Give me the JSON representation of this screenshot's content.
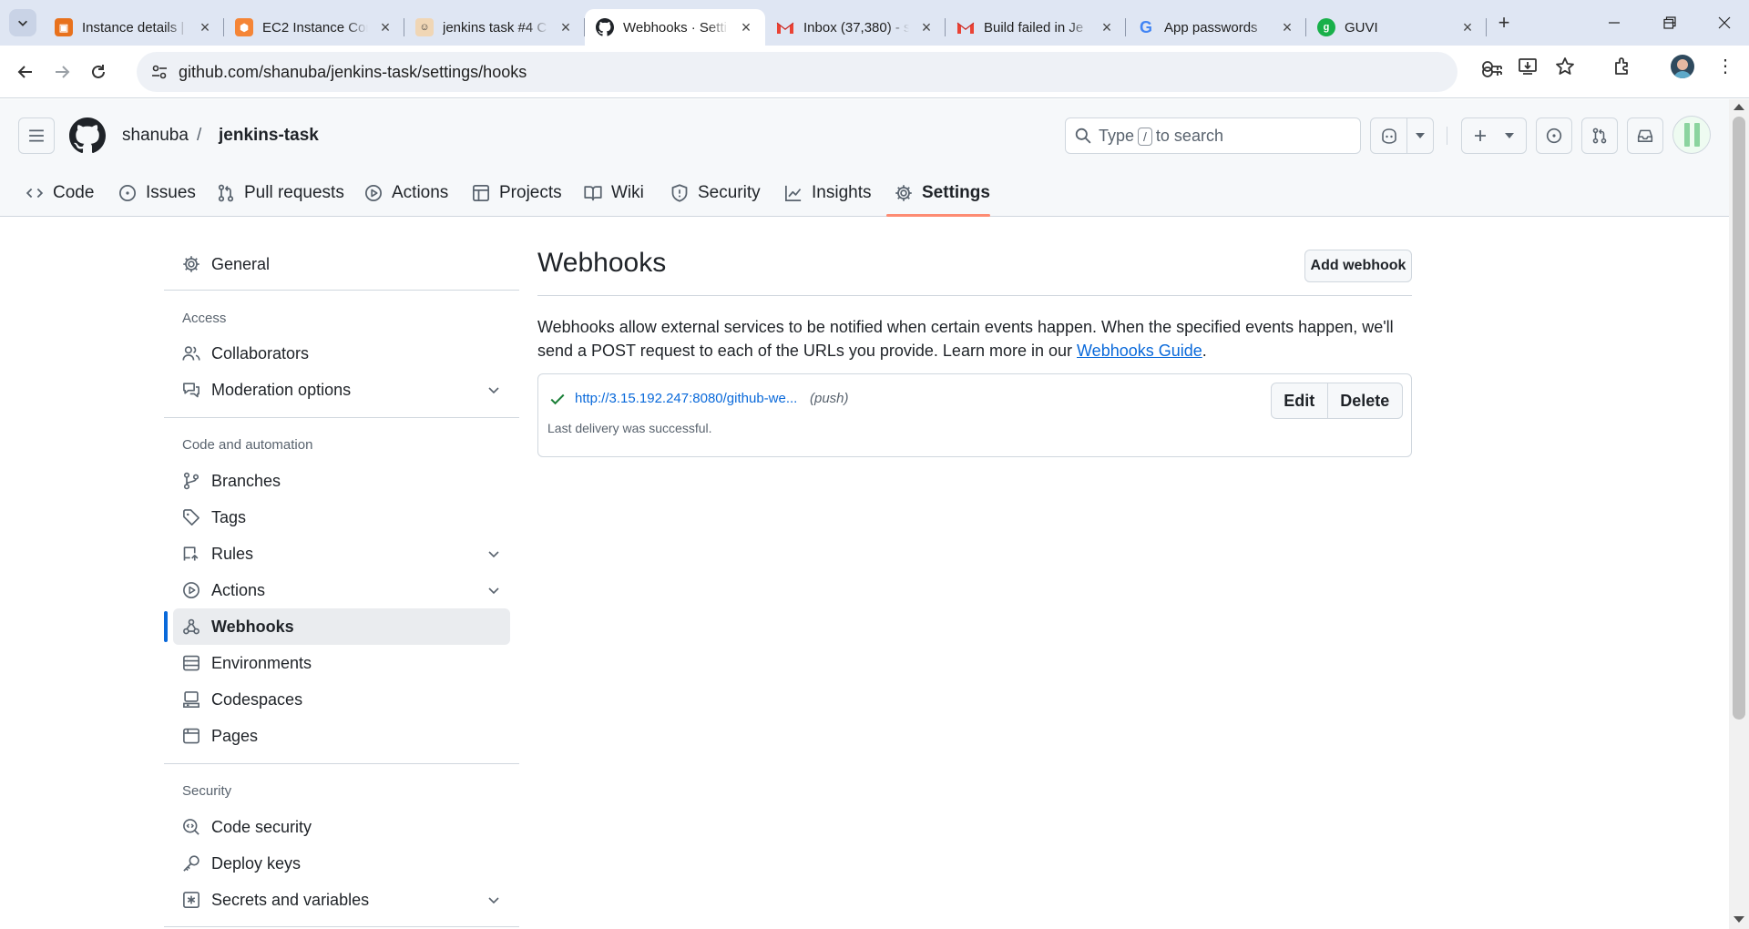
{
  "browser": {
    "tabs": [
      {
        "title": "Instance details |",
        "icon": "aws-instance-icon",
        "color": "#e8711c"
      },
      {
        "title": "EC2 Instance Con",
        "icon": "aws-ec2-icon",
        "color": "#f58536"
      },
      {
        "title": "jenkins task #4 C",
        "icon": "jenkins-icon",
        "color": "#d33833"
      },
      {
        "title": "Webhooks · Setti",
        "icon": "github-icon",
        "color": "#1f2328",
        "active": true
      },
      {
        "title": "Inbox (37,380) - s",
        "icon": "gmail-icon",
        "color": "#ea4335"
      },
      {
        "title": "Build failed in Je",
        "icon": "gmail-icon",
        "color": "#ea4335"
      },
      {
        "title": "App passwords",
        "icon": "google-icon",
        "color": "#4285f4"
      },
      {
        "title": "GUVI",
        "icon": "guvi-icon",
        "color": "#18b04a"
      }
    ],
    "url": "github.com/shanuba/jenkins-task/settings/hooks"
  },
  "header": {
    "owner": "shanuba",
    "separator": "/",
    "repo": "jenkins-task",
    "search_prefix": "Type",
    "search_key": "/",
    "search_suffix": "to search"
  },
  "repo_nav": {
    "code": "Code",
    "issues": "Issues",
    "pulls": "Pull requests",
    "actions": "Actions",
    "projects": "Projects",
    "wiki": "Wiki",
    "security": "Security",
    "insights": "Insights",
    "settings": "Settings"
  },
  "sidebar": {
    "general": "General",
    "access_heading": "Access",
    "collaborators": "Collaborators",
    "moderation": "Moderation options",
    "code_heading": "Code and automation",
    "branches": "Branches",
    "tags": "Tags",
    "rules": "Rules",
    "actions": "Actions",
    "webhooks": "Webhooks",
    "environments": "Environments",
    "codespaces": "Codespaces",
    "pages": "Pages",
    "security_heading": "Security",
    "code_security": "Code security",
    "deploy_keys": "Deploy keys",
    "secrets": "Secrets and variables"
  },
  "main": {
    "title": "Webhooks",
    "add_button": "Add webhook",
    "description": "Webhooks allow external services to be notified when certain events happen. When the specified events happen, we'll send a POST request to each of the URLs you provide. Learn more in our",
    "guide_link": "Webhooks Guide",
    "period": ".",
    "hook": {
      "url": "http://3.15.192.247:8080/github-we...",
      "events": "(push)",
      "status": "Last delivery was successful.",
      "edit": "Edit",
      "delete": "Delete"
    }
  },
  "colors": {
    "accent": "#0969da",
    "selected_tab_underline": "#fd8c73",
    "success": "#1a7f37"
  }
}
